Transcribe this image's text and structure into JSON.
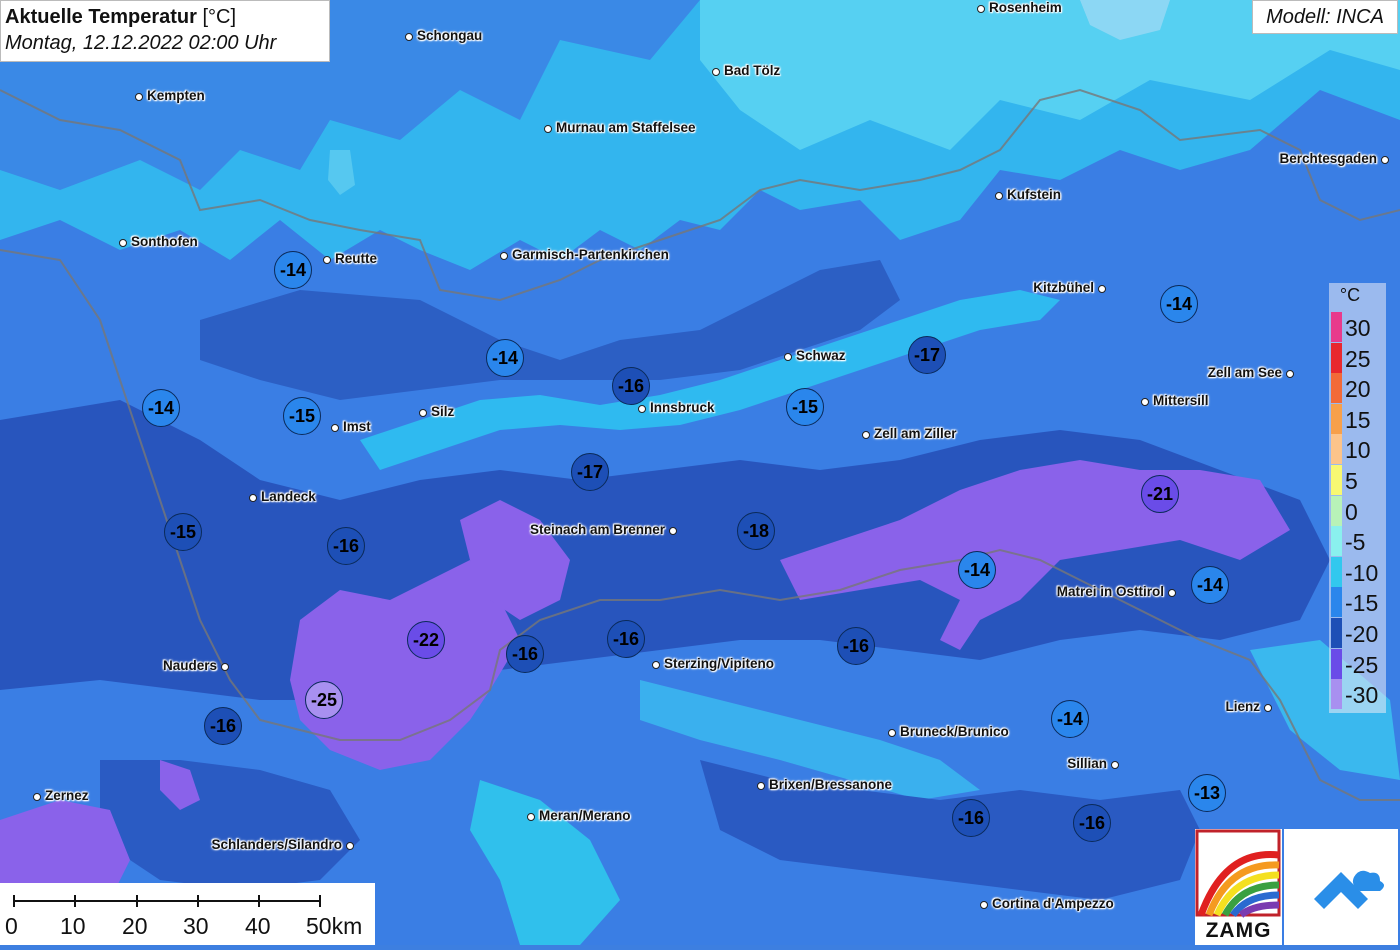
{
  "header": {
    "title": "Aktuelle Temperatur",
    "title_unit": "[°C]",
    "subtitle": "Montag, 12.12.2022 02:00 Uhr",
    "model": "Modell: INCA"
  },
  "legend": {
    "unit": "°C",
    "items": [
      {
        "label": "30",
        "color": "#e83a8c"
      },
      {
        "label": "25",
        "color": "#e8282e"
      },
      {
        "label": "20",
        "color": "#f26a38"
      },
      {
        "label": "15",
        "color": "#f7a04a"
      },
      {
        "label": "10",
        "color": "#fcc48a"
      },
      {
        "label": "5",
        "color": "#f8f872"
      },
      {
        "label": "0",
        "color": "#b8f2b8"
      },
      {
        "label": "-5",
        "color": "#8af0ee"
      },
      {
        "label": "-10",
        "color": "#32c8ee"
      },
      {
        "label": "-15",
        "color": "#2a86ec"
      },
      {
        "label": "-20",
        "color": "#1d4fb6"
      },
      {
        "label": "-25",
        "color": "#6a4ce8"
      },
      {
        "label": "-30",
        "color": "#a890f0"
      }
    ]
  },
  "cities": [
    "Rosenheim",
    "Schongau",
    "Bad Tölz",
    "Kempten",
    "Murnau am Staffelsee",
    "Berchtesgaden",
    "Kufstein",
    "Sonthofen",
    "Reutte",
    "Garmisch-Partenkirchen",
    "Kitzbühel",
    "Schwaz",
    "Zell am See",
    "Innsbruck",
    "Mittersill",
    "Imst",
    "Silz",
    "Zell am Ziller",
    "Landeck",
    "Steinach am Brenner",
    "Matrei in Osttirol",
    "Nauders",
    "Sterzing/Vipiteno",
    "Lienz",
    "Bruneck/Brunico",
    "Sillian",
    "Brixen/Bressanone",
    "Zernez",
    "Meran/Merano",
    "Schlanders/Silandro",
    "Cortina d'Ampezzo"
  ],
  "stations": [
    {
      "value": "-14",
      "color": "#2a86ec"
    },
    {
      "value": "-14",
      "color": "#2a86ec"
    },
    {
      "value": "-16",
      "color": "#1d4fb6"
    },
    {
      "value": "-17",
      "color": "#1d4fb6"
    },
    {
      "value": "-14",
      "color": "#2a86ec"
    },
    {
      "value": "-14",
      "color": "#2a86ec"
    },
    {
      "value": "-15",
      "color": "#2a86ec"
    },
    {
      "value": "-15",
      "color": "#2a86ec"
    },
    {
      "value": "-17",
      "color": "#1d4fb6"
    },
    {
      "value": "-21",
      "color": "#6a4ce8"
    },
    {
      "value": "-15",
      "color": "#1d4fb6"
    },
    {
      "value": "-16",
      "color": "#1d4fb6"
    },
    {
      "value": "-18",
      "color": "#1d4fb6"
    },
    {
      "value": "-14",
      "color": "#2a86ec"
    },
    {
      "value": "-14",
      "color": "#2a86ec"
    },
    {
      "value": "-22",
      "color": "#6a4ce8"
    },
    {
      "value": "-16",
      "color": "#1d4fb6"
    },
    {
      "value": "-16",
      "color": "#1d4fb6"
    },
    {
      "value": "-16",
      "color": "#1d4fb6"
    },
    {
      "value": "-25",
      "color": "#a890f0"
    },
    {
      "value": "-16",
      "color": "#1d4fb6"
    },
    {
      "value": "-14",
      "color": "#2a86ec"
    },
    {
      "value": "-13",
      "color": "#2a86ec"
    },
    {
      "value": "-16",
      "color": "#1d4fb6"
    },
    {
      "value": "-16",
      "color": "#1d4fb6"
    }
  ],
  "scale": {
    "labels": [
      "0",
      "10",
      "20",
      "30",
      "40",
      "50km"
    ]
  },
  "logos": {
    "zamg": "ZAMG"
  }
}
